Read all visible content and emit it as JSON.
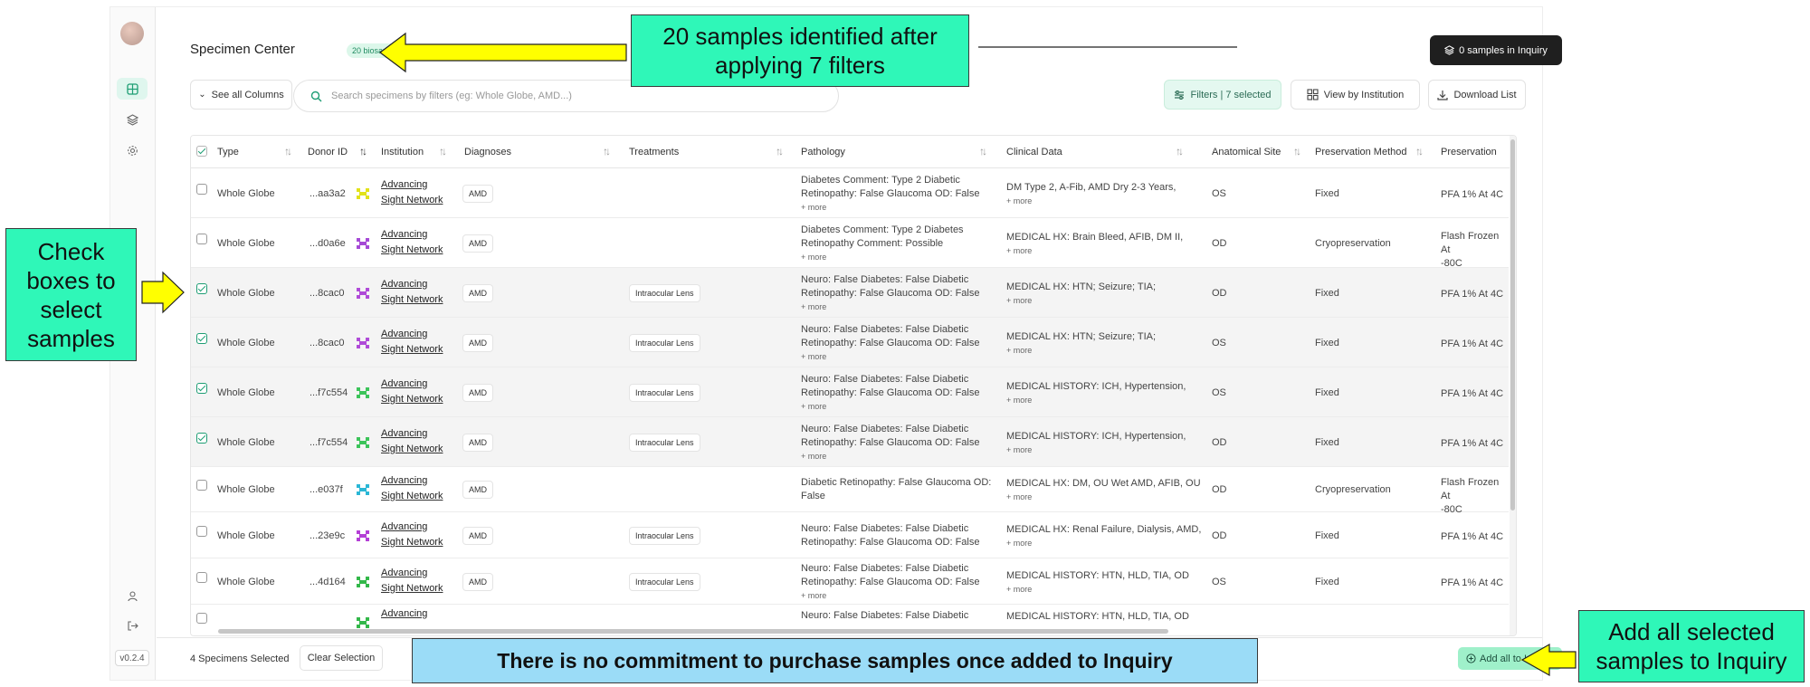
{
  "sidebar": {
    "version": "v0.2.4"
  },
  "header": {
    "title": "Specimen Center",
    "badge": "20 biosamples",
    "inquiry_button": "0 samples in Inquiry"
  },
  "toolbar": {
    "see_columns": "See all Columns",
    "search_placeholder": "Search specimens by filters (eg: Whole Globe, AMD...)",
    "filters": "Filters | 7 selected",
    "view_by_institution": "View by Institution",
    "download_list": "Download List"
  },
  "table": {
    "columns": [
      "Type",
      "Donor ID",
      "Institution",
      "Diagnoses",
      "Treatments",
      "Pathology",
      "Clinical Data",
      "Anatomical Site",
      "Preservation Method",
      "Preservation"
    ],
    "rows": [
      {
        "selected": false,
        "type": "Whole Globe",
        "donor": "...aa3a2",
        "icon_color": "#e2e21a",
        "inst1": "Advancing",
        "inst2": "Sight Network",
        "diagnosis": "AMD",
        "treatment": "",
        "path1": "Diabetes Comment: Type 2 Diabetic",
        "path2": "Retinopathy: False Glaucoma OD: False",
        "path_more": "+ more",
        "clin": "DM Type 2, A-Fib, AMD Dry 2-3 Years,",
        "clin_more": "+ more",
        "site": "OS",
        "method": "Fixed",
        "pres1": "PFA 1% At 4C",
        "pres2": ""
      },
      {
        "selected": false,
        "type": "Whole Globe",
        "donor": "...d0a6e",
        "icon_color": "#a64ad6",
        "inst1": "Advancing",
        "inst2": "Sight Network",
        "diagnosis": "AMD",
        "treatment": "",
        "path1": "Diabetes Comment: Type 2 Diabetes",
        "path2": "Retinopathy Comment: Possible",
        "path_more": "+ more",
        "clin": "MEDICAL HX: Brain Bleed, AFIB, DM II,",
        "clin_more": "+ more",
        "site": "OD",
        "method": "Cryopreservation",
        "pres1": "Flash Frozen At",
        "pres2": "-80C"
      },
      {
        "selected": true,
        "type": "Whole Globe",
        "donor": "...8cac0",
        "icon_color": "#b04bd8",
        "inst1": "Advancing",
        "inst2": "Sight Network",
        "diagnosis": "AMD",
        "treatment": "Intraocular Lens",
        "path1": "Neuro: False Diabetes: False Diabetic",
        "path2": "Retinopathy: False Glaucoma OD: False",
        "path_more": "+ more",
        "clin": "MEDICAL HX: HTN; Seizure; TIA;",
        "clin_more": "+ more",
        "site": "OD",
        "method": "Fixed",
        "pres1": "PFA 1% At 4C",
        "pres2": ""
      },
      {
        "selected": true,
        "type": "Whole Globe",
        "donor": "...8cac0",
        "icon_color": "#b04bd8",
        "inst1": "Advancing",
        "inst2": "Sight Network",
        "diagnosis": "AMD",
        "treatment": "Intraocular Lens",
        "path1": "Neuro: False Diabetes: False Diabetic",
        "path2": "Retinopathy: False Glaucoma OD: False",
        "path_more": "+ more",
        "clin": "MEDICAL HX: HTN; Seizure; TIA;",
        "clin_more": "+ more",
        "site": "OS",
        "method": "Fixed",
        "pres1": "PFA 1% At 4C",
        "pres2": ""
      },
      {
        "selected": true,
        "type": "Whole Globe",
        "donor": "...f7c554",
        "icon_color": "#3cc45a",
        "inst1": "Advancing",
        "inst2": "Sight Network",
        "diagnosis": "AMD",
        "treatment": "Intraocular Lens",
        "path1": "Neuro: False Diabetes: False Diabetic",
        "path2": "Retinopathy: False Glaucoma OD: False",
        "path_more": "+ more",
        "clin": "MEDICAL HISTORY: ICH, Hypertension,",
        "clin_more": "+ more",
        "site": "OS",
        "method": "Fixed",
        "pres1": "PFA 1% At 4C",
        "pres2": ""
      },
      {
        "selected": true,
        "type": "Whole Globe",
        "donor": "...f7c554",
        "icon_color": "#3cc45a",
        "inst1": "Advancing",
        "inst2": "Sight Network",
        "diagnosis": "AMD",
        "treatment": "Intraocular Lens",
        "path1": "Neuro: False Diabetes: False Diabetic",
        "path2": "Retinopathy: False Glaucoma OD: False",
        "path_more": "+ more",
        "clin": "MEDICAL HISTORY: ICH, Hypertension,",
        "clin_more": "+ more",
        "site": "OD",
        "method": "Fixed",
        "pres1": "PFA 1% At 4C",
        "pres2": ""
      },
      {
        "selected": false,
        "type": "Whole Globe",
        "donor": "...e037f",
        "icon_color": "#2bb7d6",
        "inst1": "Advancing",
        "inst2": "Sight Network",
        "diagnosis": "AMD",
        "treatment": "",
        "path1": "Diabetic Retinopathy: False Glaucoma OD:",
        "path2": "False",
        "path_more": "",
        "clin": "MEDICAL HX: DM, OU Wet AMD, AFIB, OU",
        "clin_more": "+ more",
        "site": "OD",
        "method": "Cryopreservation",
        "pres1": "Flash Frozen At",
        "pres2": "-80C"
      },
      {
        "selected": false,
        "type": "Whole Globe",
        "donor": "...23e9c",
        "icon_color": "#b43fd6",
        "inst1": "Advancing",
        "inst2": "Sight Network",
        "diagnosis": "AMD",
        "treatment": "Intraocular Lens",
        "path1": "Neuro: False Diabetes: False Diabetic",
        "path2": "Retinopathy: False Glaucoma OD: False",
        "path_more": "",
        "clin": "MEDICAL HX: Renal Failure, Dialysis, AMD,",
        "clin_more": "+ more",
        "site": "OD",
        "method": "Fixed",
        "pres1": "PFA 1% At 4C",
        "pres2": ""
      },
      {
        "selected": false,
        "type": "Whole Globe",
        "donor": "...4d164",
        "icon_color": "#33b84a",
        "inst1": "Advancing",
        "inst2": "Sight Network",
        "diagnosis": "AMD",
        "treatment": "Intraocular Lens",
        "path1": "Neuro: False Diabetes: False Diabetic",
        "path2": "Retinopathy: False Glaucoma OD: False",
        "path_more": "+ more",
        "clin": "MEDICAL HISTORY: HTN, HLD, TIA, OD",
        "clin_more": "+ more",
        "site": "OS",
        "method": "Fixed",
        "pres1": "PFA 1% At 4C",
        "pres2": ""
      },
      {
        "selected": false,
        "type": "",
        "donor": "",
        "icon_color": "#33b84a",
        "inst1": "Advancing",
        "inst2": "",
        "diagnosis": "",
        "treatment": "",
        "path1": "Neuro: False Diabetes: False Diabetic",
        "path2": "",
        "path_more": "",
        "clin": "MEDICAL HISTORY: HTN, HLD, TIA, OD",
        "clin_more": "",
        "site": "",
        "method": "",
        "pres1": "",
        "pres2": ""
      }
    ]
  },
  "footer": {
    "selected_count": "4 Specimens Selected",
    "clear_selection": "Clear Selection",
    "add_all": "Add all to Inquiry"
  },
  "annotations": {
    "top_callout": "20 samples identified after applying 7 filters",
    "left_callout": "Check boxes to select samples",
    "right_callout": "Add all selected samples to Inquiry",
    "bottom_banner": "There is no commitment to purchase samples once added to Inquiry"
  },
  "colors": {
    "callout_green": "#2ff7b8",
    "banner_blue": "#9bdcf7",
    "arrow_yellow": "#ffff00",
    "accent_green": "#1e9e74"
  }
}
